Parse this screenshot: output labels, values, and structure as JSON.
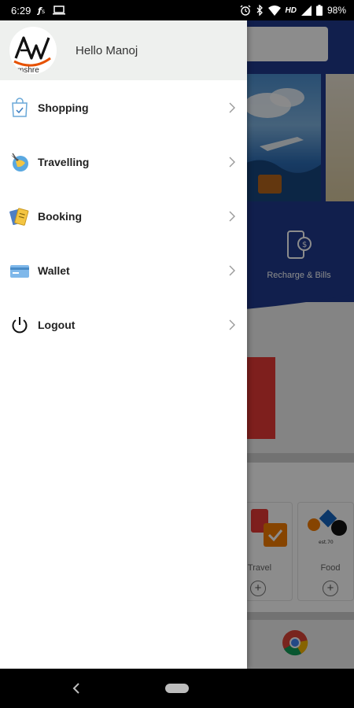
{
  "status_bar": {
    "time": "6:29",
    "battery": "98%",
    "network": "HD"
  },
  "drawer": {
    "greeting": "Hello Manoj",
    "logo_text": "mshre",
    "items": [
      {
        "label": "Shopping",
        "icon": "shopping-bag-icon"
      },
      {
        "label": "Travelling",
        "icon": "travel-globe-icon"
      },
      {
        "label": "Booking",
        "icon": "ticket-icon"
      },
      {
        "label": "Wallet",
        "icon": "wallet-icon"
      },
      {
        "label": "Logout",
        "icon": "power-icon"
      }
    ]
  },
  "background_app": {
    "recharge_label": "Recharge & Bills",
    "card_travel_label": "Travel",
    "card_food_label": "Food",
    "accent_color": "#1f3a8c"
  }
}
